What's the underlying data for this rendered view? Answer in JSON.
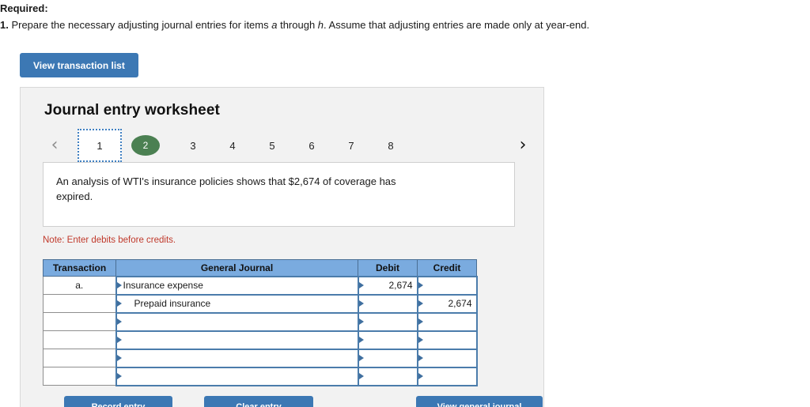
{
  "required": {
    "label": "Required:",
    "number": "1.",
    "text_part1": " Prepare the necessary adjusting journal entries for items ",
    "item_from": "a",
    "text_part2": " through ",
    "item_to": "h",
    "text_part3": ". Assume that adjusting entries are made only at year-end."
  },
  "toolbar": {
    "view_transaction_list_label": "View transaction list"
  },
  "worksheet": {
    "title": "Journal entry worksheet",
    "prev_icon": "chevron-left-icon",
    "next_icon": "chevron-right-icon",
    "tabs": [
      {
        "label": "1",
        "state": "focused"
      },
      {
        "label": "2",
        "state": "active"
      },
      {
        "label": "3",
        "state": "normal"
      },
      {
        "label": "4",
        "state": "normal"
      },
      {
        "label": "5",
        "state": "normal"
      },
      {
        "label": "6",
        "state": "normal"
      },
      {
        "label": "7",
        "state": "normal"
      },
      {
        "label": "8",
        "state": "normal"
      }
    ],
    "question": "An analysis of WTI's insurance policies shows that $2,674 of coverage has expired.",
    "note": "Note: Enter debits before credits."
  },
  "journal": {
    "headers": [
      "Transaction",
      "General Journal",
      "Debit",
      "Credit"
    ],
    "rows": [
      {
        "transaction": "a.",
        "account": "Insurance expense",
        "indent": false,
        "debit": "2,674",
        "credit": ""
      },
      {
        "transaction": "",
        "account": "Prepaid insurance",
        "indent": true,
        "debit": "",
        "credit": "2,674"
      },
      {
        "transaction": "",
        "account": "",
        "indent": false,
        "debit": "",
        "credit": ""
      },
      {
        "transaction": "",
        "account": "",
        "indent": false,
        "debit": "",
        "credit": ""
      },
      {
        "transaction": "",
        "account": "",
        "indent": false,
        "debit": "",
        "credit": ""
      },
      {
        "transaction": "",
        "account": "",
        "indent": false,
        "debit": "",
        "credit": ""
      }
    ]
  },
  "footer": {
    "buttons": [
      {
        "label": "Record entry"
      },
      {
        "label": "Clear entry"
      },
      {
        "label": "View general journal"
      }
    ]
  },
  "colors": {
    "primary_button": "#3c78b4",
    "table_header": "#7aabdf",
    "active_tab": "#4b8052",
    "note_text": "#c0392b",
    "panel_bg": "#f2f2f2",
    "input_border": "#4b7cab"
  }
}
